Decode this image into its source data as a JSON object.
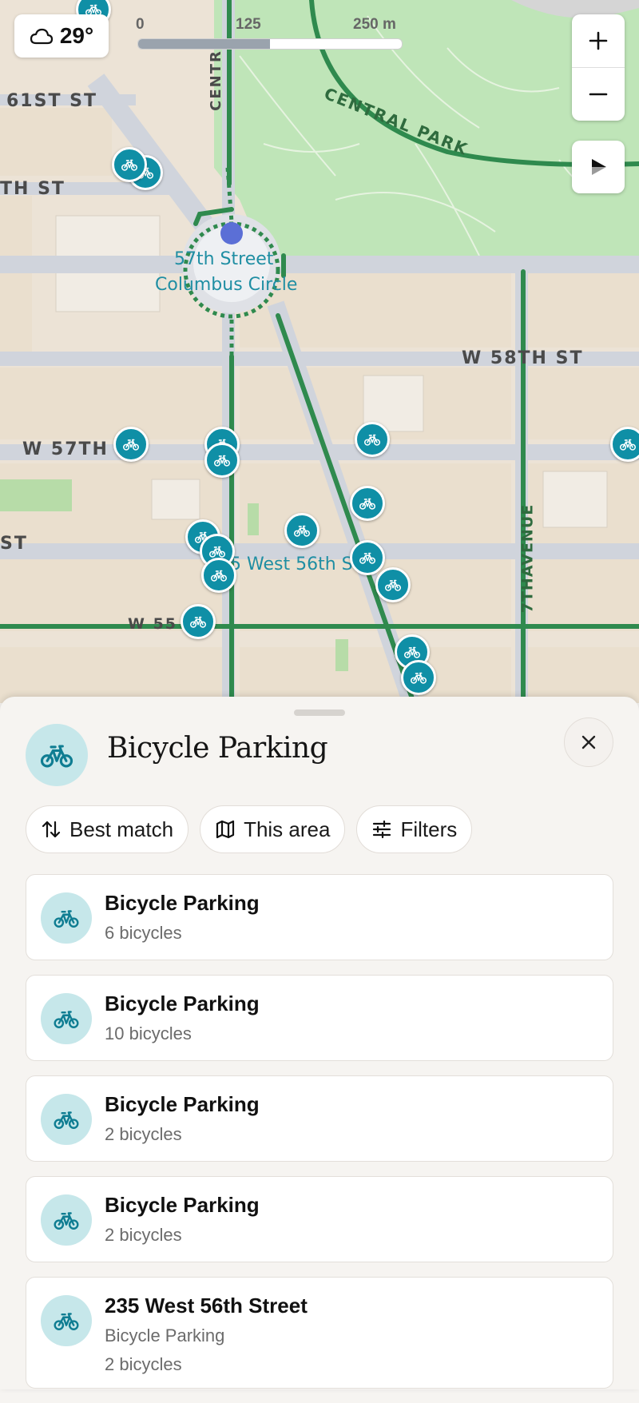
{
  "map": {
    "weather": {
      "icon": "cloud-icon",
      "temperature": "29°"
    },
    "scale": {
      "labels": [
        "0",
        "125",
        "250 m"
      ]
    },
    "controls": {
      "zoom_in": "+",
      "zoom_out": "−"
    },
    "street_labels": {
      "st61": "61ST ST",
      "th_st": "TH ST",
      "central_park": "CENTRAL PARK",
      "w58": "W 58TH ST",
      "w57": "W 57TH",
      "w5_right": "W",
      "st": "ST",
      "w55": "W 55",
      "seventh_ave": "7THAVENUE",
      "centr": "CENTR"
    },
    "poi_labels": {
      "columbus_line1": "57th Street",
      "columbus_line2": "Columbus Circle",
      "west56": "5 West 56th St"
    }
  },
  "sheet": {
    "title": "Bicycle Parking",
    "header_icon": "bicycle-icon",
    "close_icon": "close-icon",
    "chips": [
      {
        "label": "Best match",
        "icon": "sort-icon"
      },
      {
        "label": "This area",
        "icon": "map-icon"
      },
      {
        "label": "Filters",
        "icon": "sliders-icon"
      }
    ],
    "results": [
      {
        "title": "Bicycle Parking",
        "subtitle": "6 bicycles"
      },
      {
        "title": "Bicycle Parking",
        "subtitle": "10 bicycles"
      },
      {
        "title": "Bicycle Parking",
        "subtitle": "2 bicycles"
      },
      {
        "title": "Bicycle Parking",
        "subtitle": "2 bicycles"
      },
      {
        "title": "235 West 56th Street",
        "subtitle": "Bicycle Parking",
        "detail": "2 bicycles"
      }
    ]
  },
  "colors": {
    "accent_teal": "#0f8fa6",
    "route_green": "#2f8a4e",
    "park_green": "#bfe5b8"
  }
}
